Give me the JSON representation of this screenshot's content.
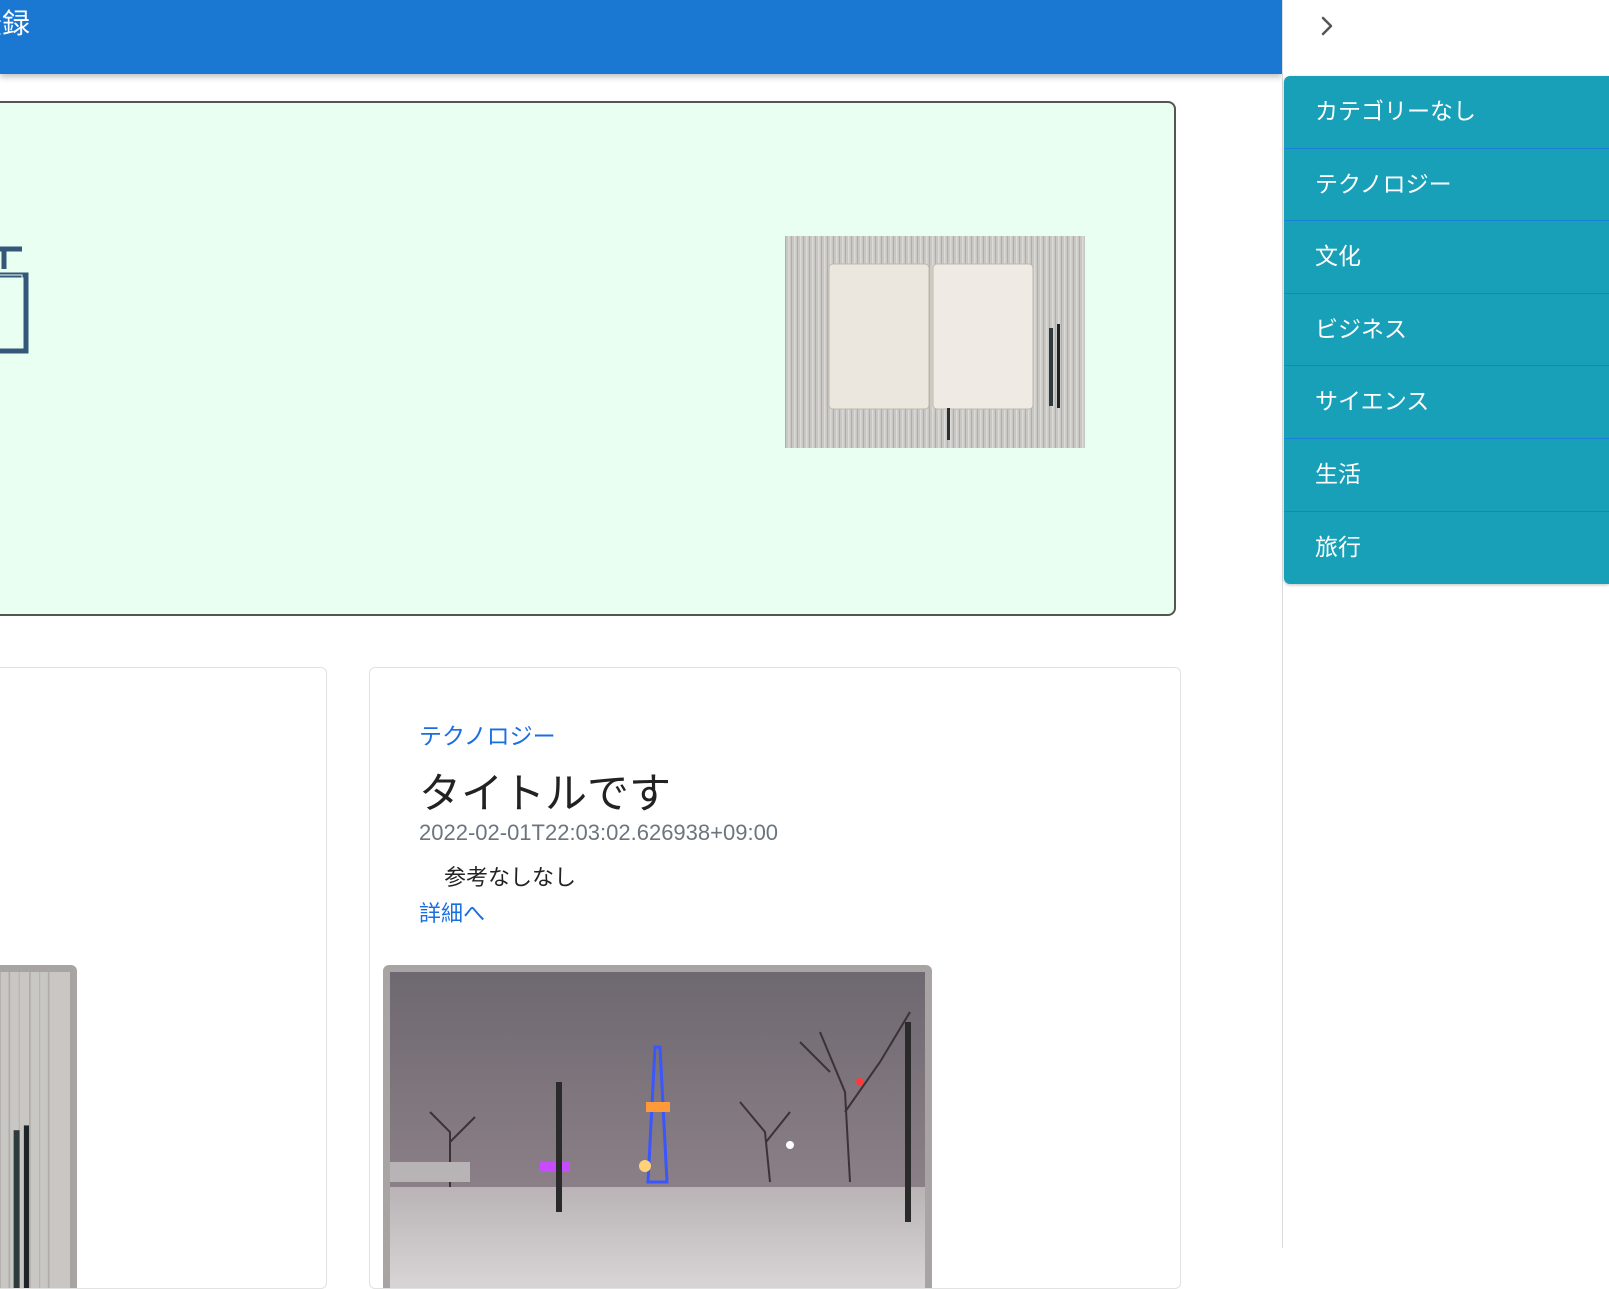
{
  "header": {
    "title": "登録"
  },
  "sidebar": {
    "toggle_icon": "chevron-right-icon",
    "categories": [
      {
        "label": "カテゴリーなし"
      },
      {
        "label": "テクノロジー"
      },
      {
        "label": "文化"
      },
      {
        "label": "ビジネス"
      },
      {
        "label": "サイエンス"
      },
      {
        "label": "生活"
      },
      {
        "label": "旅行"
      }
    ]
  },
  "post": {
    "category": "テクノロジー",
    "title": "タイトルです",
    "date": "2022-02-01T22:03:02.626938+09:00",
    "body": "参考なしなし",
    "link": "詳細へ"
  },
  "colors": {
    "header": "#1b78d2",
    "category_bg": "#17a0b8",
    "hero_bg": "#e8fff1",
    "link": "#1a6fe0"
  }
}
